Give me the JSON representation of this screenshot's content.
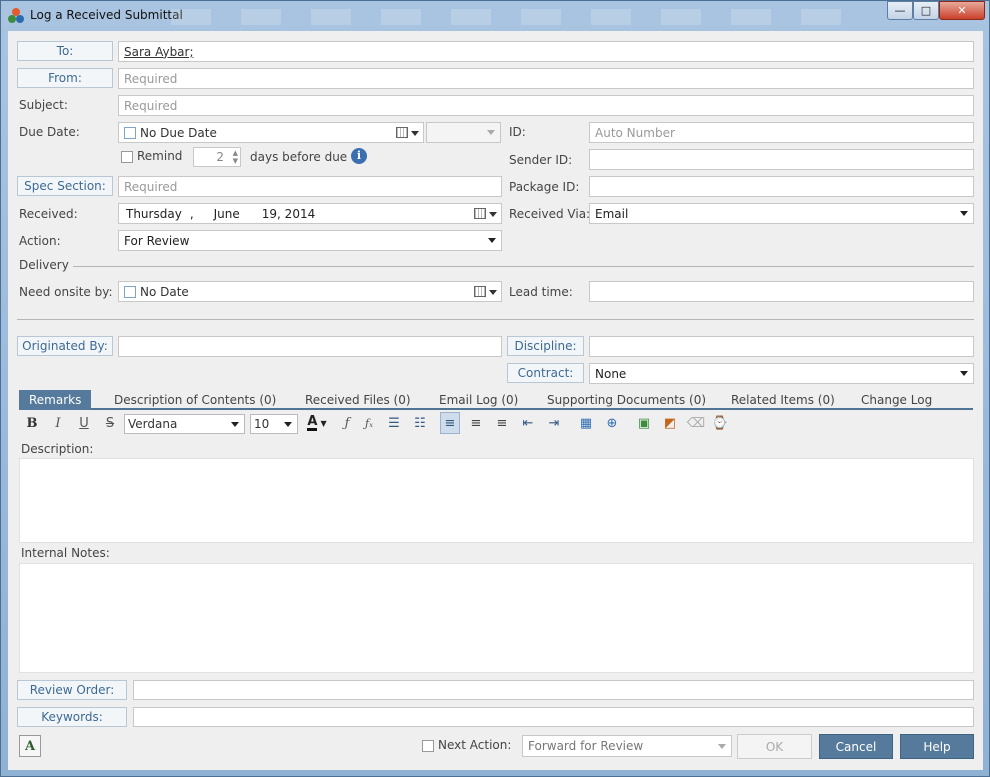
{
  "window": {
    "title": "Log a Received Submittal",
    "controls": {
      "minimize": "—",
      "maximize": "□",
      "close": "✕"
    }
  },
  "form": {
    "to": {
      "label": "To:",
      "value": "Sara Aybar;"
    },
    "from": {
      "label": "From:",
      "placeholder": "Required"
    },
    "subject": {
      "label": "Subject:",
      "placeholder": "Required"
    },
    "due_date": {
      "label": "Due Date:",
      "value": "No Due Date"
    },
    "remind": {
      "label": "Remind",
      "days": "2",
      "suffix": "days before due"
    },
    "id": {
      "label": "ID:",
      "placeholder": "Auto Number"
    },
    "sender_id": {
      "label": "Sender ID:"
    },
    "spec_section": {
      "label": "Spec Section:",
      "placeholder": "Required"
    },
    "package_id": {
      "label": "Package ID:"
    },
    "received": {
      "label": "Received:",
      "weekday": "Thursday",
      "comma": ",",
      "month": "June",
      "day_year": "19, 2014"
    },
    "received_via": {
      "label": "Received Via:",
      "value": "Email"
    },
    "action": {
      "label": "Action:",
      "value": "For Review"
    },
    "delivery": {
      "label": "Delivery"
    },
    "need_onsite": {
      "label": "Need onsite by:",
      "value": "No Date"
    },
    "lead_time": {
      "label": "Lead time:"
    },
    "originated_by": {
      "label": "Originated By:"
    },
    "discipline": {
      "label": "Discipline:"
    },
    "contract": {
      "label": "Contract:",
      "value": "None"
    }
  },
  "tabs": [
    {
      "label": "Remarks"
    },
    {
      "label": "Description of Contents (0)"
    },
    {
      "label": "Received Files (0)"
    },
    {
      "label": "Email Log (0)"
    },
    {
      "label": "Supporting Documents (0)"
    },
    {
      "label": "Related Items (0)"
    },
    {
      "label": "Change Log"
    }
  ],
  "toolbar": {
    "bold": "B",
    "italic": "I",
    "underline": "U",
    "strike": "S",
    "font": "Verdana",
    "size": "10",
    "font_color": "A"
  },
  "remarks": {
    "description_label": "Description:",
    "internal_notes_label": "Internal Notes:"
  },
  "review_order": {
    "label": "Review Order:"
  },
  "keywords": {
    "label": "Keywords:"
  },
  "footer": {
    "next_action_label": "Next Action:",
    "next_action_value": "Forward for Review",
    "ok": "OK",
    "cancel": "Cancel",
    "help": "Help"
  },
  "colors": {
    "accent": "#557a9b",
    "link": "#3d6a93",
    "info": "#3b6fb0"
  }
}
